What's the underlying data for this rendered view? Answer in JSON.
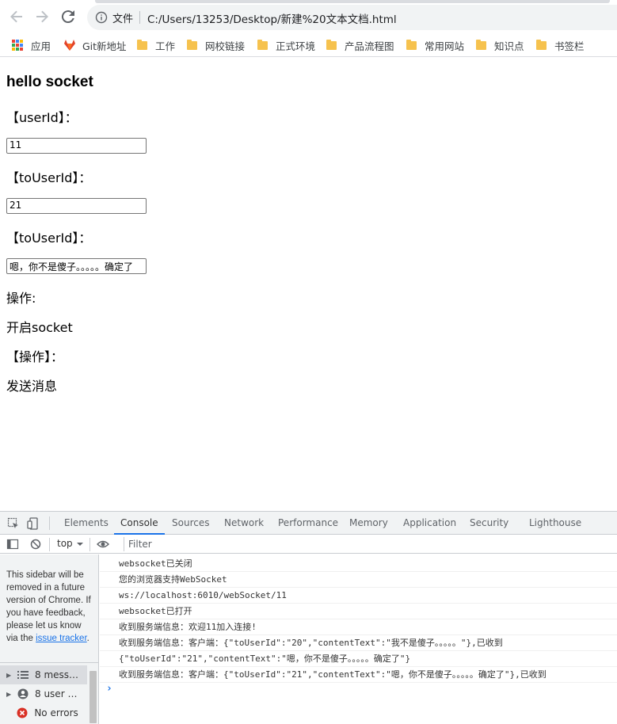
{
  "browser": {
    "security_label": "文件",
    "url": "C:/Users/13253/Desktop/新建%20文本文档.html",
    "bookmarks": [
      {
        "label": "应用",
        "icon": "apps-grid-icon"
      },
      {
        "label": "Git新地址",
        "icon": "gitlab-icon"
      },
      {
        "label": "工作",
        "icon": "folder-icon"
      },
      {
        "label": "网校链接",
        "icon": "folder-icon"
      },
      {
        "label": "正式环境",
        "icon": "folder-icon"
      },
      {
        "label": "产品流程图",
        "icon": "folder-icon"
      },
      {
        "label": "常用网站",
        "icon": "folder-icon"
      },
      {
        "label": "知识点",
        "icon": "folder-icon"
      },
      {
        "label": "书签栏",
        "icon": "folder-icon"
      }
    ]
  },
  "page": {
    "title": "hello socket",
    "user_id_label": "【userId】：",
    "user_id_value": "11",
    "to_user_id_label": "【toUserId】：",
    "to_user_id_value": "21",
    "content_label": "【toUserId】：",
    "content_value": "嗯，你不是傻子。。。。。确定了",
    "operation_label": "操作:",
    "open_socket": "开启socket",
    "operation_label2": "【操作】：",
    "send_message": "发送消息"
  },
  "devtools": {
    "tabs": [
      "Elements",
      "Console",
      "Sources",
      "Network",
      "Performance",
      "Memory",
      "Application",
      "Security",
      "Lighthouse"
    ],
    "active_tab": "Console",
    "context": "top",
    "filter_placeholder": "Filter",
    "sidebar_note": "This sidebar will be removed in a future version of Chrome. If you have feedback, please let us know via the",
    "sidebar_link": "issue tracker",
    "sidebar_note_end": ".",
    "sidebar_items": [
      {
        "label": "8 messa...",
        "icon": "list-icon"
      },
      {
        "label": "8 user m...",
        "icon": "user-icon"
      },
      {
        "label": "No errors",
        "icon": "error-icon"
      }
    ],
    "console_lines": [
      "websocket已关闭",
      "您的浏览器支持WebSocket",
      "ws://localhost:6010/webSocket/11",
      "websocket已打开",
      "收到服务端信息：欢迎11加入连接!",
      "收到服务端信息：客户端：{\"toUserId\":\"20\",\"contentText\":\"我不是傻子。。。。。\"},已收到",
      "{\"toUserId\":\"21\",\"contentText\":\"嗯，你不是傻子。。。。。确定了\"}",
      "收到服务端信息：客户端：{\"toUserId\":\"21\",\"contentText\":\"嗯，你不是傻子。。。。。确定了\"},已收到"
    ],
    "prompt": "›"
  }
}
